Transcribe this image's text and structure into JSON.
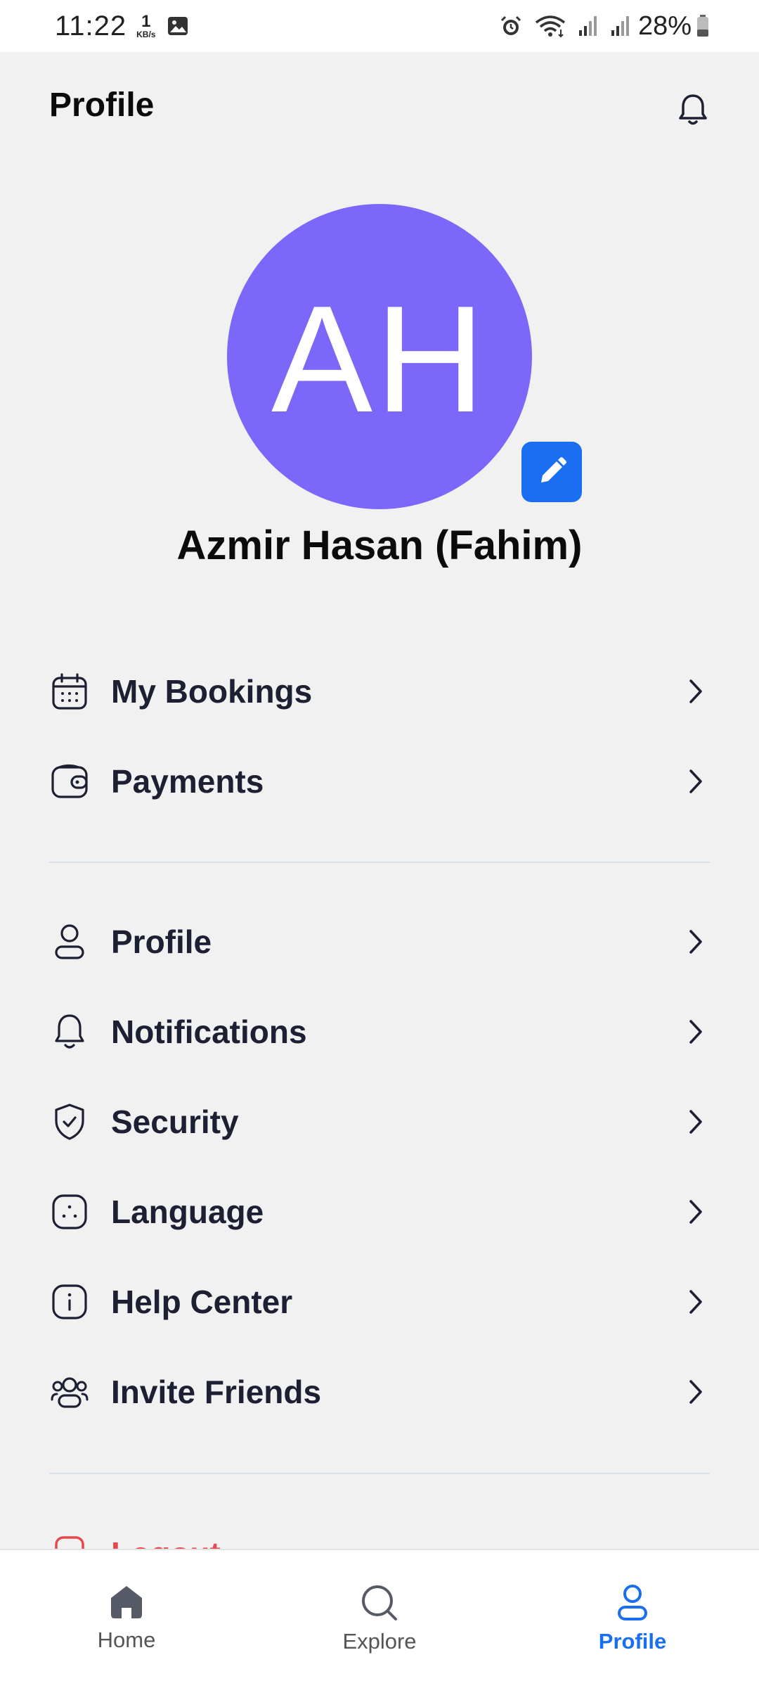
{
  "status_bar": {
    "time": "11:22",
    "net_speed_value": "1",
    "net_speed_unit": "KB/s",
    "battery": "28%"
  },
  "header": {
    "title": "Profile"
  },
  "profile": {
    "initials": "AH",
    "name": "Azmir Hasan (Fahim)",
    "avatar_color": "#7b68fa",
    "edit_button_color": "#1a6ff0"
  },
  "menu": {
    "group1": [
      {
        "label": "My Bookings",
        "icon": "calendar-icon"
      },
      {
        "label": "Payments",
        "icon": "wallet-icon"
      }
    ],
    "group2": [
      {
        "label": "Profile",
        "icon": "user-icon"
      },
      {
        "label": "Notifications",
        "icon": "bell-icon"
      },
      {
        "label": "Security",
        "icon": "shield-icon"
      },
      {
        "label": "Language",
        "icon": "language-icon"
      },
      {
        "label": "Help Center",
        "icon": "info-icon"
      },
      {
        "label": "Invite Friends",
        "icon": "users-icon"
      }
    ],
    "logout": {
      "label": "Logout",
      "icon": "logout-icon",
      "color": "#e5484d"
    }
  },
  "bottom_nav": {
    "items": [
      {
        "label": "Home",
        "icon": "home-icon",
        "active": false
      },
      {
        "label": "Explore",
        "icon": "search-icon",
        "active": false
      },
      {
        "label": "Profile",
        "icon": "user-icon",
        "active": true
      }
    ],
    "active_color": "#1a6ff0"
  }
}
